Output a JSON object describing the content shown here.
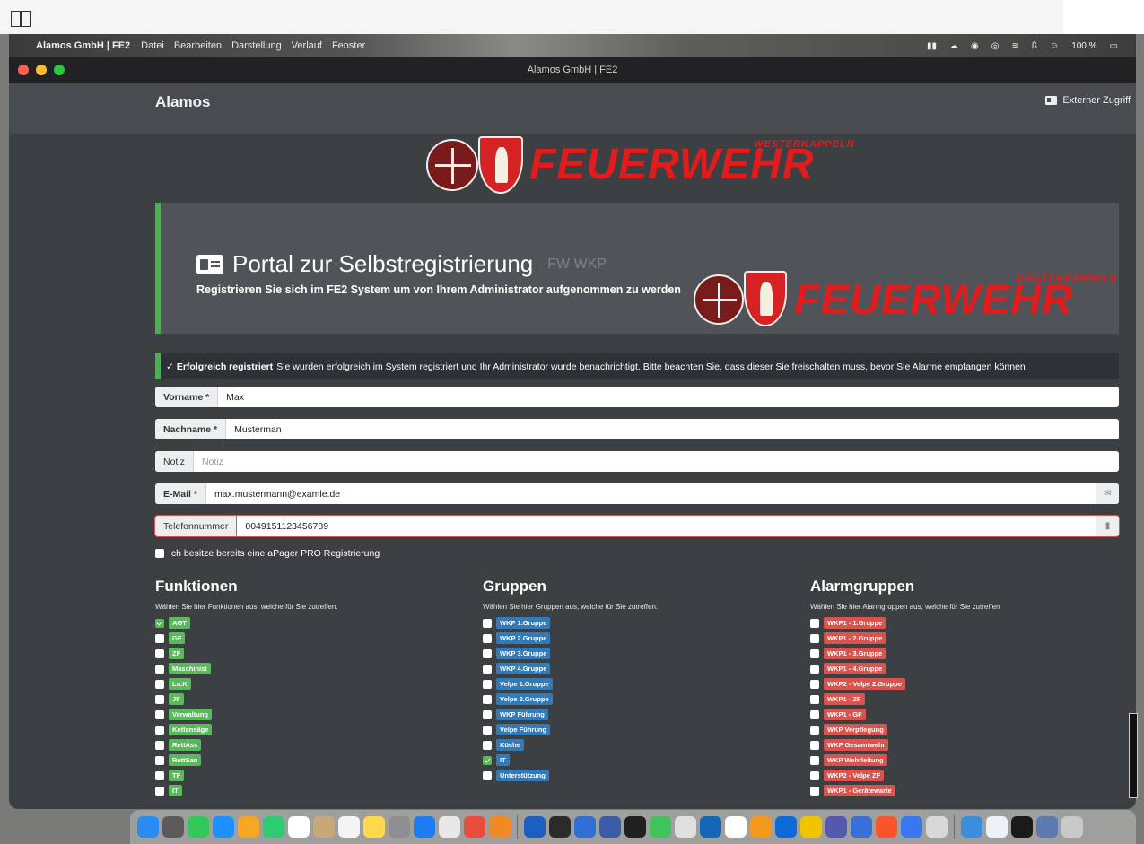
{
  "menubar": {
    "app_name": "Alamos GmbH | FE2",
    "items": [
      "Datei",
      "Bearbeiten",
      "Darstellung",
      "Verlauf",
      "Fenster"
    ],
    "battery": "100 %"
  },
  "window": {
    "title": "Alamos GmbH | FE2"
  },
  "navbar": {
    "brand": "Alamos",
    "external_access": "Externer Zugriff"
  },
  "logo": {
    "word": "FEUERWEHR",
    "sub": "WESTERKAPPELN"
  },
  "hero": {
    "title": "Portal zur Selbstregistrierung",
    "title_suffix": "FW WKP",
    "subtitle": "Registrieren Sie sich im FE2 System um von Ihrem Administrator aufgenommen zu werden"
  },
  "alert": {
    "icon": "✓",
    "bold": "Erfolgreich registriert",
    "text": "Sie wurden erfolgreich im System registriert und Ihr Administrator wurde benachrichtigt. Bitte beachten Sie, dass dieser Sie freischalten muss, bevor Sie Alarme empfangen können"
  },
  "form": {
    "firstname": {
      "label": "Vorname *",
      "value": "Max"
    },
    "lastname": {
      "label": "Nachname *",
      "value": "Musterman"
    },
    "note": {
      "label": "Notiz",
      "placeholder": "Notiz"
    },
    "email": {
      "label": "E-Mail *",
      "value": "max.mustermann@examle.de"
    },
    "phone": {
      "label": "Telefonnummer",
      "value": "0049151123456789"
    },
    "apager_label": "Ich besitze bereits eine aPager PRO Registrierung"
  },
  "funktionen": {
    "title": "Funktionen",
    "hint": "Wählen Sie hier Funktionen aus, welche für Sie zutreffen.",
    "items": [
      {
        "label": "AGT",
        "checked": true
      },
      {
        "label": "GF",
        "checked": false
      },
      {
        "label": "ZF",
        "checked": false
      },
      {
        "label": "Maschinist",
        "checked": false
      },
      {
        "label": "Lu.K",
        "checked": false
      },
      {
        "label": "JF",
        "checked": false
      },
      {
        "label": "Verwaltung",
        "checked": false
      },
      {
        "label": "Kettensäge",
        "checked": false
      },
      {
        "label": "RettAss",
        "checked": false
      },
      {
        "label": "RettSan",
        "checked": false
      },
      {
        "label": "TF",
        "checked": false
      },
      {
        "label": "IT",
        "checked": false
      }
    ]
  },
  "gruppen": {
    "title": "Gruppen",
    "hint": "Wählen Sie hier Gruppen aus, welche für Sie zutreffen.",
    "items": [
      {
        "label": "WKP 1.Gruppe",
        "checked": false
      },
      {
        "label": "WKP 2.Gruppe",
        "checked": false
      },
      {
        "label": "WKP 3.Gruppe",
        "checked": false
      },
      {
        "label": "WKP 4.Gruppe",
        "checked": false
      },
      {
        "label": "Velpe 1.Gruppe",
        "checked": false
      },
      {
        "label": "Velpe 2.Gruppe",
        "checked": false
      },
      {
        "label": "WKP Führung",
        "checked": false
      },
      {
        "label": "Velpe Führung",
        "checked": false
      },
      {
        "label": "Küche",
        "checked": false
      },
      {
        "label": "IT",
        "checked": true
      },
      {
        "label": "Unterstützung",
        "checked": false
      }
    ]
  },
  "alarmgruppen": {
    "title": "Alarmgruppen",
    "hint": "Wählen Sie hier Alarmgruppen aus, welche für Sie zutreffen",
    "items": [
      {
        "label": "WKP1 - 1.Gruppe",
        "checked": false
      },
      {
        "label": "WKP1 - 2.Gruppe",
        "checked": false
      },
      {
        "label": "WKP1 - 3.Gruppe",
        "checked": false
      },
      {
        "label": "WKP1 - 4.Gruppe",
        "checked": false
      },
      {
        "label": "WKP2 - Velpe 2.Gruppe",
        "checked": false
      },
      {
        "label": "WKP1 - ZF",
        "checked": false
      },
      {
        "label": "WKP1 - GF",
        "checked": false
      },
      {
        "label": "WKP Verpflegung",
        "checked": false
      },
      {
        "label": "WKP Gesamtwehr",
        "checked": false
      },
      {
        "label": "WKP Wehrleitung",
        "checked": false
      },
      {
        "label": "WKP2 - Velpe ZF",
        "checked": false
      },
      {
        "label": "WKP1 - Gerätewarte",
        "checked": false
      }
    ]
  },
  "colors": {
    "accent_green": "#4caf50",
    "tag_green": "#5cb85c",
    "tag_blue": "#337ab7",
    "tag_red": "#d9534f",
    "logo_red": "#e21c1c"
  },
  "dock": {
    "icons": [
      "finder-icon",
      "calculator-icon",
      "messages-icon",
      "safari-icon",
      "photos-icon",
      "facetime-icon",
      "calendar-icon",
      "contacts-icon",
      "reminders-icon",
      "notes-icon",
      "system-settings-icon",
      "app-store-icon",
      "chrome-icon",
      "git-icon",
      "office-icon",
      "bitwarden-icon",
      "terminal-icon",
      "powershell-icon",
      "remote-icon",
      "chatgpt-icon",
      "whatsapp-icon",
      "gift-icon",
      "outlook-icon",
      "calendar-app-icon",
      "sublime-icon",
      "teamviewer-icon",
      "chrome-canary-icon",
      "teams-icon",
      "vpn-icon",
      "brave-icon",
      "signal-icon",
      "airport-icon",
      "printer-icon",
      "files-icon",
      "document-icon",
      "downloads-icon",
      "trash-icon"
    ]
  }
}
